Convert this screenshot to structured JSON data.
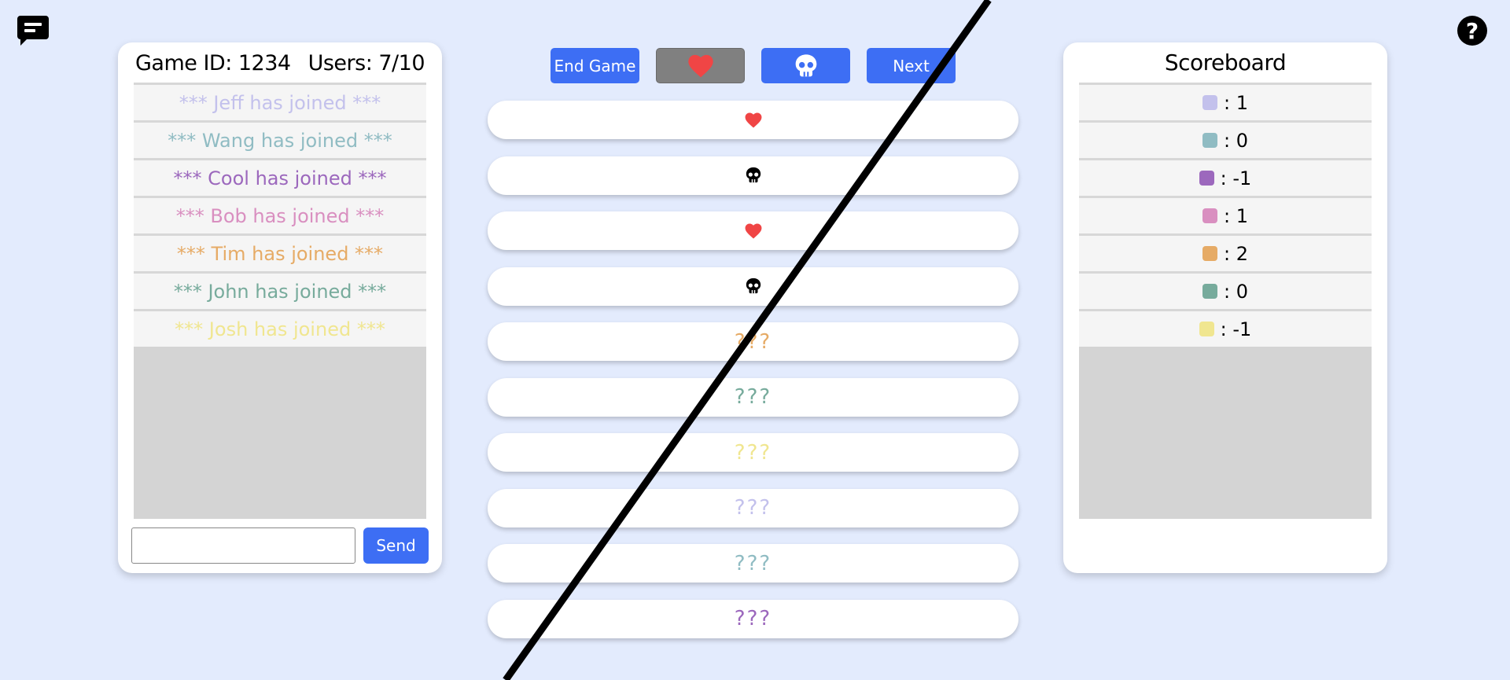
{
  "chat_panel": {
    "game_id_text": "Game ID: 1234",
    "users_text": "Users: 7/10",
    "messages": [
      {
        "text": "*** Jeff has joined ***",
        "color": "#c3c1ec"
      },
      {
        "text": "*** Wang has joined ***",
        "color": "#90bcc3"
      },
      {
        "text": "*** Cool has joined ***",
        "color": "#9c68bd"
      },
      {
        "text": "*** Bob has joined ***",
        "color": "#d98fc0"
      },
      {
        "text": "*** Tim has joined ***",
        "color": "#e6ab66"
      },
      {
        "text": "*** John has joined ***",
        "color": "#77ab9c"
      },
      {
        "text": "*** Josh has joined ***",
        "color": "#f0e690"
      }
    ],
    "input_value": "",
    "send_label": "Send"
  },
  "controls": {
    "end_game_label": "End Game",
    "heart_icon": "heart-icon",
    "skull_icon": "skull-icon",
    "next_label": "Next"
  },
  "answers": [
    {
      "type": "heart",
      "color": "#f04545"
    },
    {
      "type": "skull",
      "color": "#000000"
    },
    {
      "type": "heart",
      "color": "#f04545"
    },
    {
      "type": "skull",
      "color": "#000000"
    },
    {
      "type": "text",
      "text": "???",
      "color": "#e6ab66"
    },
    {
      "type": "text",
      "text": "???",
      "color": "#77ab9c"
    },
    {
      "type": "text",
      "text": "???",
      "color": "#f0e690"
    },
    {
      "type": "text",
      "text": "???",
      "color": "#c3c1ec"
    },
    {
      "type": "text",
      "text": "???",
      "color": "#90bcc3"
    },
    {
      "type": "text",
      "text": "???",
      "color": "#9c68bd"
    }
  ],
  "scoreboard": {
    "title": "Scoreboard",
    "rows": [
      {
        "color": "#c3c1ec",
        "score": ": 1"
      },
      {
        "color": "#90bcc3",
        "score": ": 0"
      },
      {
        "color": "#9c68bd",
        "score": ": -1"
      },
      {
        "color": "#d98fc0",
        "score": ": 1"
      },
      {
        "color": "#e6ab66",
        "score": ": 2"
      },
      {
        "color": "#77ab9c",
        "score": ": 0"
      },
      {
        "color": "#f0e690",
        "score": ": -1"
      }
    ]
  },
  "colors": {
    "background": "#e3ebfd",
    "button_blue": "#3d6ef4",
    "button_grey": "#808080"
  },
  "icons": {
    "chat_toggle": "chat-bubble-icon",
    "help": "question-mark-icon"
  }
}
